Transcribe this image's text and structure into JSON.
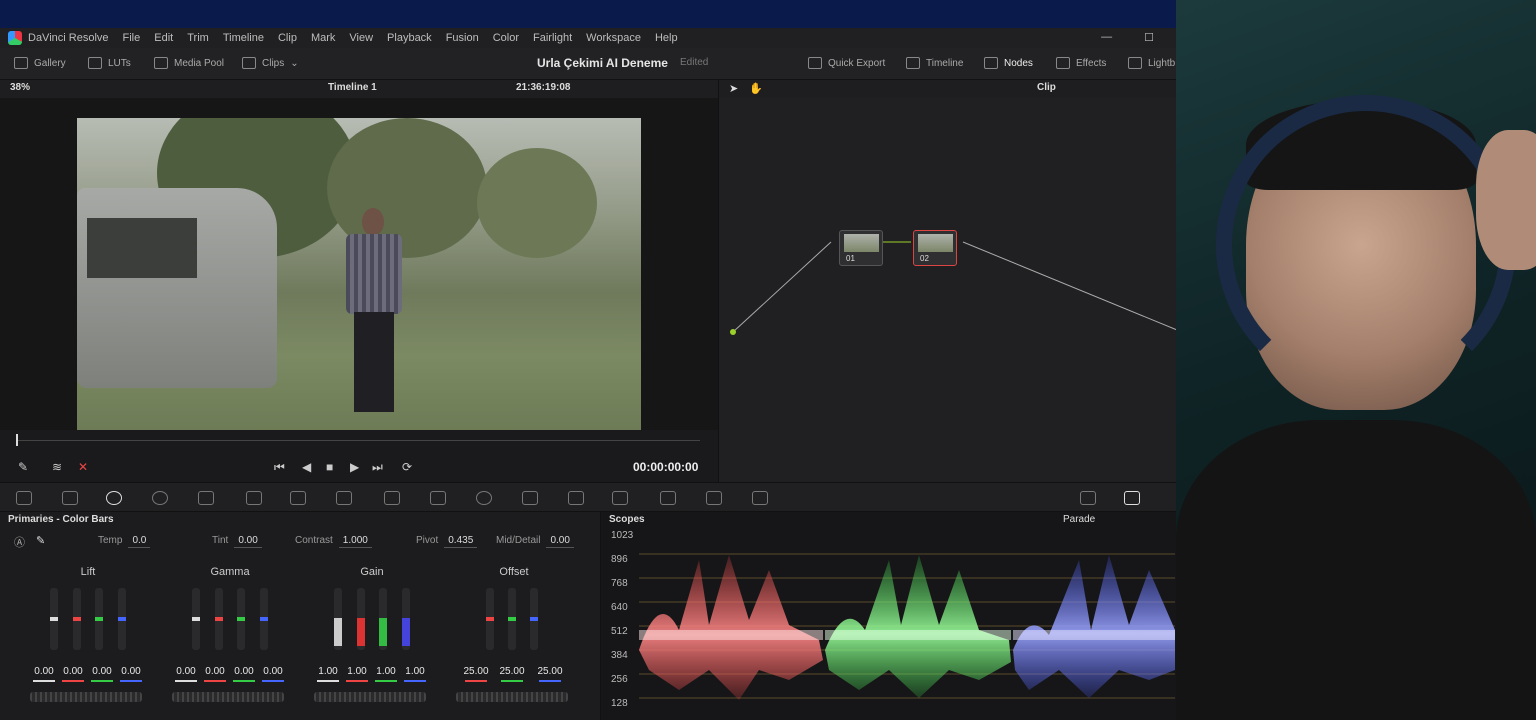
{
  "menu": {
    "app_name": "DaVinci Resolve",
    "items": [
      "File",
      "Edit",
      "Trim",
      "Timeline",
      "Clip",
      "Mark",
      "View",
      "Playback",
      "Fusion",
      "Color",
      "Fairlight",
      "Workspace",
      "Help"
    ]
  },
  "toolbar": {
    "gallery": "Gallery",
    "luts": "LUTs",
    "media_pool": "Media Pool",
    "clips": "Clips",
    "project_title": "Urla Çekimi AI Deneme",
    "project_status": "Edited",
    "quick_export": "Quick Export",
    "timeline": "Timeline",
    "nodes": "Nodes",
    "effects": "Effects",
    "lightbox": "Lightb"
  },
  "viewer": {
    "zoom": "38%",
    "timeline_name": "Timeline 1",
    "source_timecode": "21:36:19:08",
    "playhead_timecode": "00:00:00:00"
  },
  "node_editor": {
    "mode": "Clip",
    "nodes": [
      {
        "label": "01"
      },
      {
        "label": "02"
      }
    ]
  },
  "primaries": {
    "title": "Primaries - Color Bars",
    "temp_label": "Temp",
    "temp": "0.0",
    "tint_label": "Tint",
    "tint": "0.00",
    "contrast_label": "Contrast",
    "contrast": "1.000",
    "pivot_label": "Pivot",
    "pivot": "0.435",
    "middetail_label": "Mid/Detail",
    "middetail": "0.00",
    "wheels": [
      {
        "name": "Lift",
        "values": [
          "0.00",
          "0.00",
          "0.00",
          "0.00"
        ]
      },
      {
        "name": "Gamma",
        "values": [
          "0.00",
          "0.00",
          "0.00",
          "0.00"
        ]
      },
      {
        "name": "Gain",
        "values": [
          "1.00",
          "1.00",
          "1.00",
          "1.00"
        ]
      },
      {
        "name": "Offset",
        "values": [
          "25.00",
          "25.00",
          "25.00"
        ]
      }
    ]
  },
  "scopes": {
    "title": "Scopes",
    "mode": "Parade",
    "y_labels": [
      "1023",
      "896",
      "768",
      "640",
      "512",
      "384",
      "256",
      "128"
    ]
  },
  "colors": {
    "accent_red": "#ff4a4a",
    "accent_green": "#3ddc4a",
    "accent_blue": "#4a5cff",
    "node_link": "#9bd12a"
  }
}
